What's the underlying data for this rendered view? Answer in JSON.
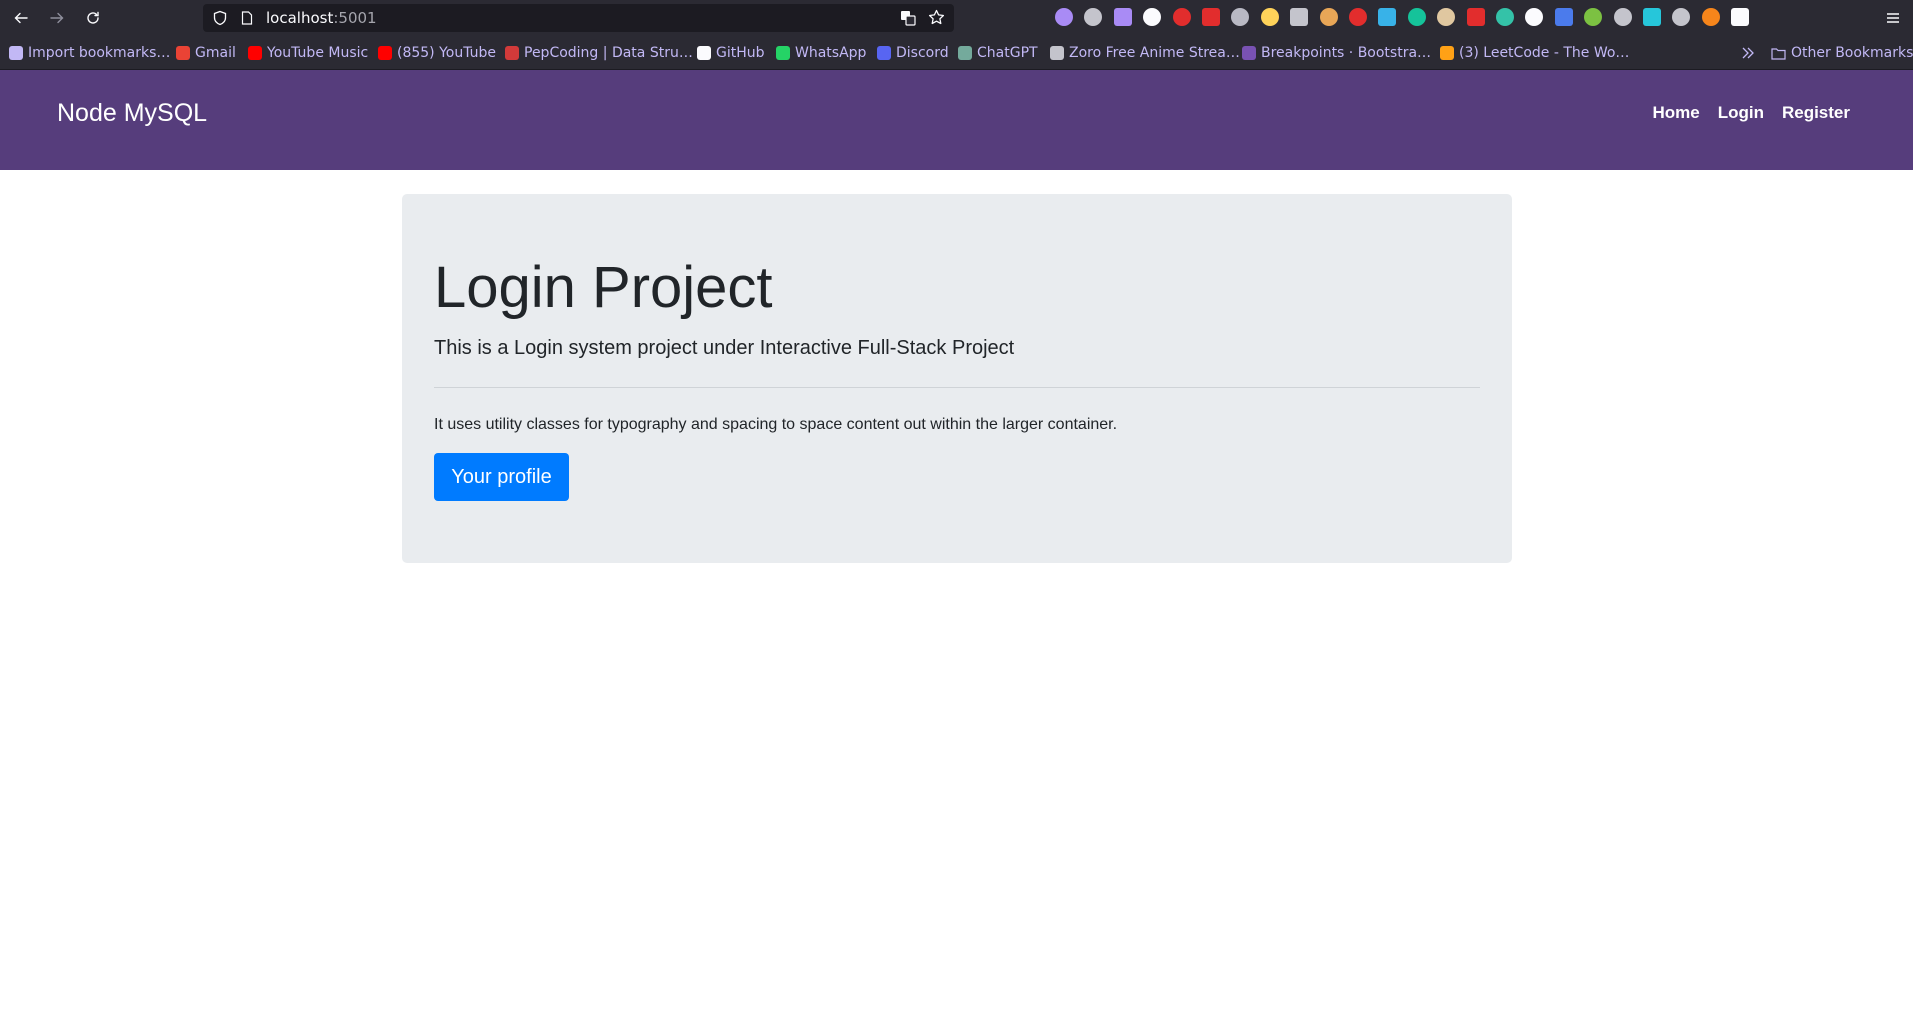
{
  "browser": {
    "url_host": "localhost",
    "url_port": ":5001",
    "icons": [
      "back-arrow-icon",
      "forward-arrow-icon",
      "reload-icon",
      "shield-icon",
      "page-icon",
      "translate-icon",
      "star-icon",
      "overflow-chevron-icon",
      "folder-icon",
      "menu-icon"
    ],
    "extension_colors": [
      "#a98bf5",
      "#c4c4cc",
      "#a98bf5",
      "#fbfbfe",
      "#e22d2d",
      "#e22d2d",
      "#b9b9c4",
      "#ffd35a",
      "#c4c4cc",
      "#e8a657",
      "#e22d2d",
      "#38b2e8",
      "#15c39a",
      "#e0c7a0",
      "#e22d2d",
      "#34c2a8",
      "#fbfbfe",
      "#4b7bec",
      "#7cc142",
      "#c4c4cc",
      "#26c6da",
      "#c4c4cc",
      "#f6851b",
      "#fbfbfe"
    ]
  },
  "bookmarks": {
    "items": [
      {
        "label": "Import bookmarks…",
        "color": "#c2b8f5"
      },
      {
        "label": "Gmail",
        "color": "#ea4335"
      },
      {
        "label": "YouTube Music",
        "color": "#ff0000"
      },
      {
        "label": "(855) YouTube",
        "color": "#ff0000"
      },
      {
        "label": "PepCoding | Data Stru…",
        "color": "#d23a3a"
      },
      {
        "label": "GitHub",
        "color": "#fbfbfe"
      },
      {
        "label": "WhatsApp",
        "color": "#25d366"
      },
      {
        "label": "Discord",
        "color": "#5865f2"
      },
      {
        "label": "ChatGPT",
        "color": "#74aa9c"
      },
      {
        "label": "Zoro Free Anime Strea…",
        "color": "#c4c4cc"
      },
      {
        "label": "Breakpoints · Bootstra…",
        "color": "#7952b3"
      },
      {
        "label": "(3) LeetCode - The Wo…",
        "color": "#ffa116"
      }
    ],
    "other_label": "Other Bookmarks"
  },
  "navbar": {
    "brand": "Node MySQL",
    "links": [
      "Home",
      "Login",
      "Register"
    ],
    "bg_color": "#563d7c"
  },
  "jumbotron": {
    "title": "Login Project",
    "lead": "This is a Login system project under Interactive Full-Stack Project",
    "text": "It uses utility classes for typography and spacing to space content out within the larger container.",
    "button_label": "Your profile",
    "button_color": "#007bff"
  }
}
